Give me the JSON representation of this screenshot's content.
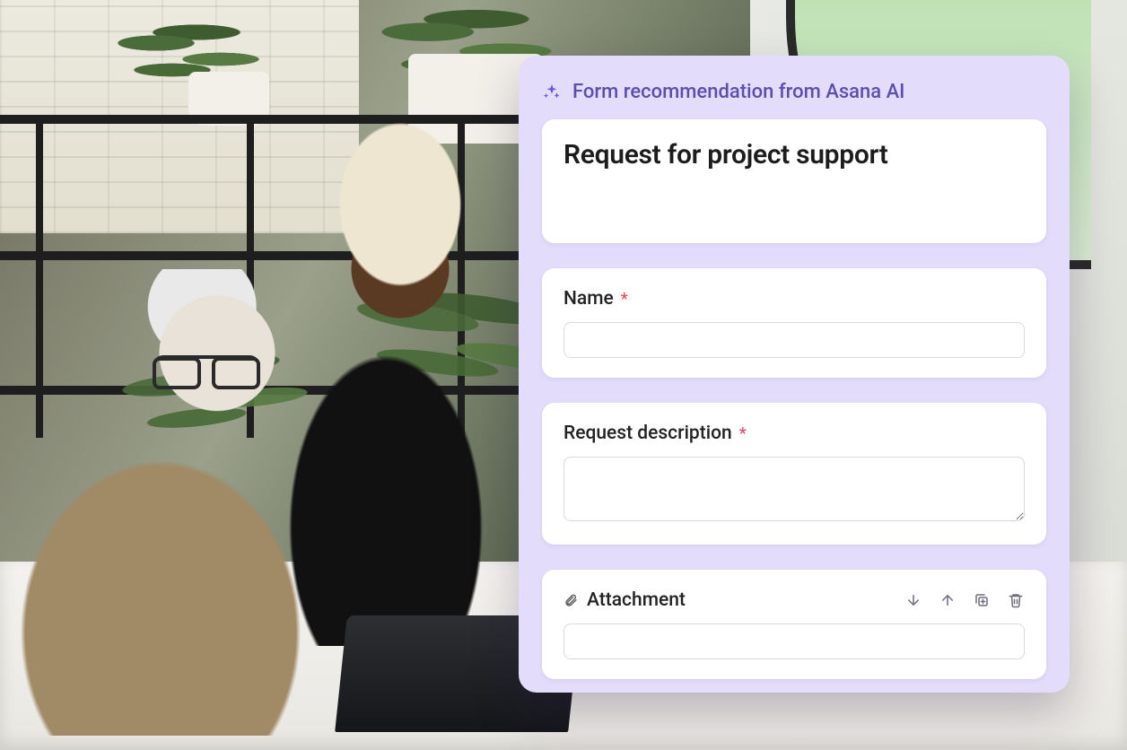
{
  "panel": {
    "header": "Form recommendation from Asana AI",
    "form_title": "Request for project support",
    "fields": {
      "name": {
        "label": "Name",
        "required": true
      },
      "description": {
        "label": "Request description",
        "required": true
      },
      "attachment": {
        "label": "Attachment"
      }
    },
    "required_marker": "*",
    "colors": {
      "panel_bg": "#e3ddfb",
      "accent": "#6a5ae0",
      "required": "#e14d5a"
    }
  }
}
